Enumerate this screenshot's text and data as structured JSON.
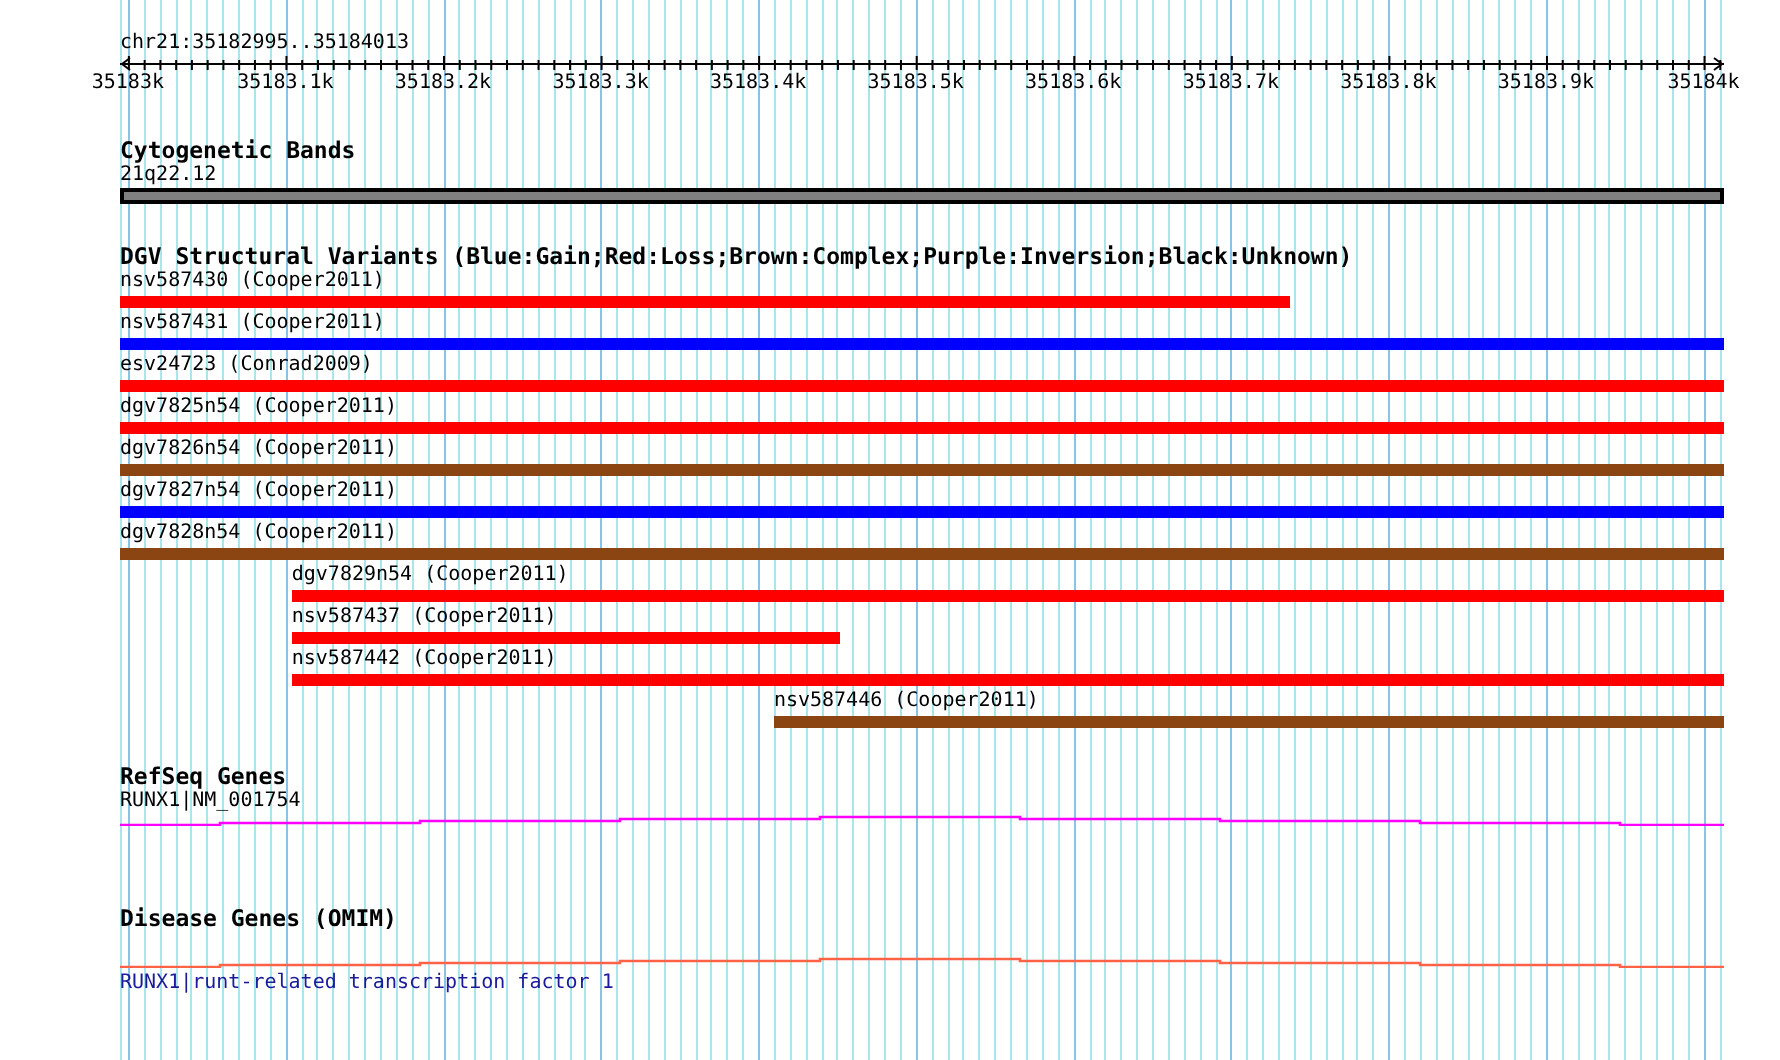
{
  "ruler": {
    "position": "chr21:35182995..35184013",
    "tick_labels": [
      "35183k",
      "35183.1k",
      "35183.2k",
      "35183.3k",
      "35183.4k",
      "35183.5k",
      "35183.6k",
      "35183.7k",
      "35183.8k",
      "35183.9k",
      "35184k"
    ]
  },
  "tracks": [
    {
      "kind": "band",
      "title": "Cytogenetic Bands",
      "features": [
        {
          "label": "21q22.12"
        }
      ]
    },
    {
      "kind": "variants",
      "title": "DGV Structural Variants (Blue:Gain;Red:Loss;Brown:Complex;Purple:Inversion;Black:Unknown)",
      "features": [
        {
          "label": "nsv587430 (Cooper2011)",
          "color": "#ff0000"
        },
        {
          "label": "nsv587431 (Cooper2011)",
          "color": "#0000ff"
        },
        {
          "label": "esv24723 (Conrad2009)",
          "color": "#ff0000"
        },
        {
          "label": "dgv7825n54 (Cooper2011)",
          "color": "#ff0000"
        },
        {
          "label": "dgv7826n54 (Cooper2011)",
          "color": "#8b4513"
        },
        {
          "label": "dgv7827n54 (Cooper2011)",
          "color": "#0000ff"
        },
        {
          "label": "dgv7828n54 (Cooper2011)",
          "color": "#8b4513"
        },
        {
          "label": "dgv7829n54 (Cooper2011)",
          "color": "#ff0000"
        },
        {
          "label": "nsv587437 (Cooper2011)",
          "color": "#ff0000"
        },
        {
          "label": "nsv587442 (Cooper2011)",
          "color": "#ff0000"
        },
        {
          "label": "nsv587446 (Cooper2011)",
          "color": "#8b4513"
        }
      ]
    },
    {
      "kind": "gene",
      "title": "RefSeq Genes",
      "features": [
        {
          "label": "RUNX1|NM_001754",
          "color": "#ff00ff"
        }
      ]
    },
    {
      "kind": "disease",
      "title": "Disease Genes (OMIM)",
      "features": [
        {
          "label": "RUNX1|runt-related transcription factor 1",
          "color": "#ff6347"
        }
      ]
    }
  ]
}
